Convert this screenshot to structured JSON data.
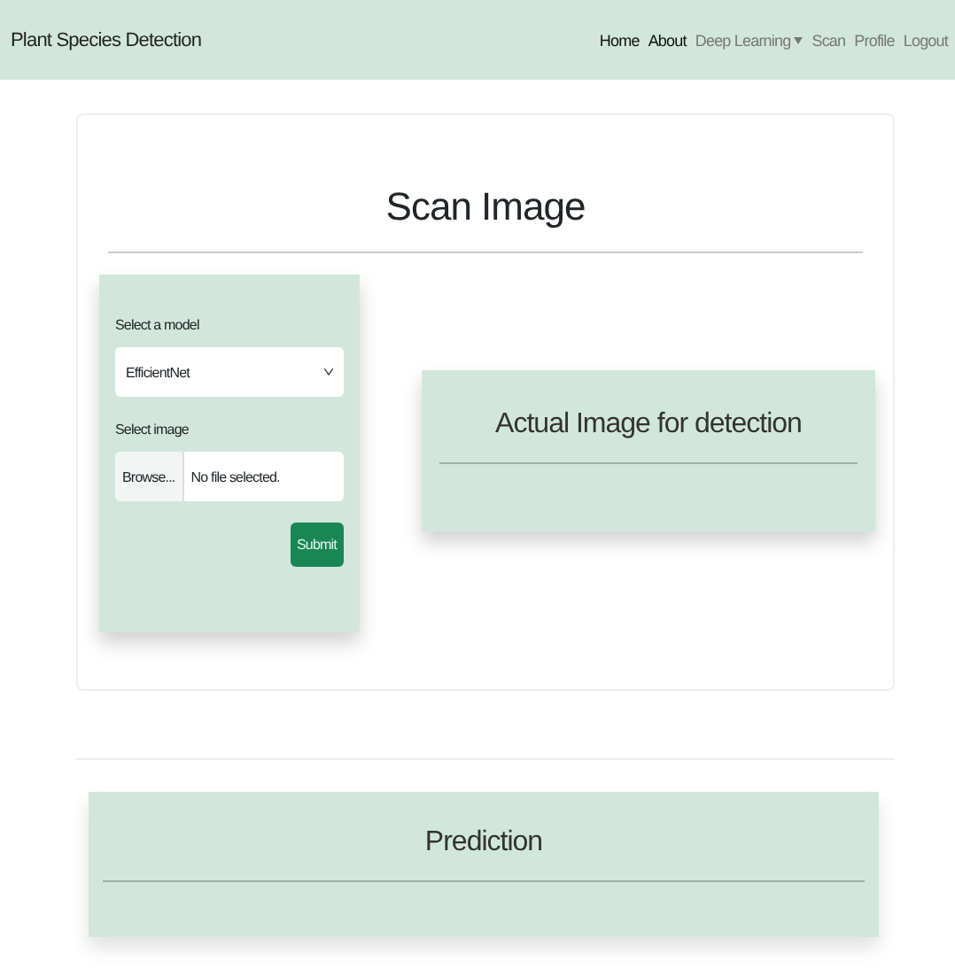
{
  "navbar": {
    "brand": "Plant Species Detection",
    "links": [
      {
        "label": "Home",
        "active": true,
        "dropdown": false
      },
      {
        "label": "About",
        "active": true,
        "dropdown": false
      },
      {
        "label": "Deep Learning",
        "active": false,
        "dropdown": true
      },
      {
        "label": "Scan",
        "active": false,
        "dropdown": false
      },
      {
        "label": "Profile",
        "active": false,
        "dropdown": false
      },
      {
        "label": "Logout",
        "active": false,
        "dropdown": false
      }
    ]
  },
  "scan": {
    "title": "Scan Image",
    "form": {
      "model_label": "Select a model",
      "model_value": "EfficientNet",
      "image_label": "Select image",
      "browse": "Browse...",
      "file_status": "No file selected.",
      "submit": "Submit"
    },
    "preview_title": "Actual Image for detection"
  },
  "prediction": {
    "title": "Prediction"
  }
}
